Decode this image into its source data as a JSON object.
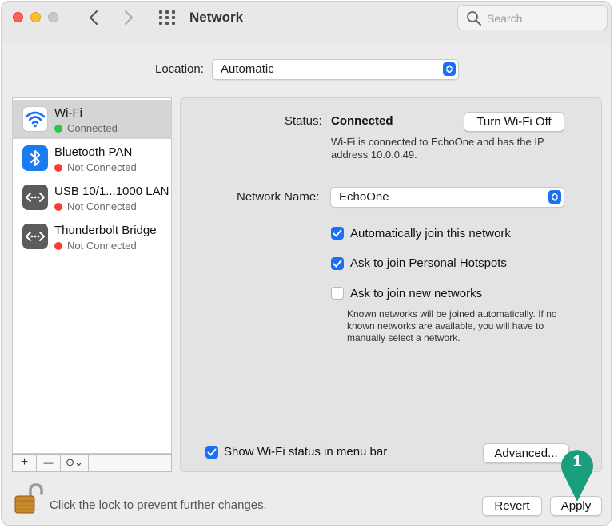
{
  "window": {
    "title": "Network",
    "search_placeholder": "Search"
  },
  "location": {
    "label": "Location:",
    "value": "Automatic"
  },
  "services": [
    {
      "name": "Wi-Fi",
      "status": "Connected",
      "status_color": "#28c840",
      "icon": "wifi-icon",
      "selected": true
    },
    {
      "name": "Bluetooth PAN",
      "status": "Not Connected",
      "status_color": "#ff3b30",
      "icon": "bluetooth-icon",
      "selected": false
    },
    {
      "name": "USB 10/1...1000 LAN",
      "status": "Not Connected",
      "status_color": "#ff3b30",
      "icon": "ethernet-icon",
      "selected": false
    },
    {
      "name": "Thunderbolt Bridge",
      "status": "Not Connected",
      "status_color": "#ff3b30",
      "icon": "ethernet-icon",
      "selected": false
    }
  ],
  "sidebar_tools": {
    "add": "+",
    "remove": "—",
    "action": "⊙⌄"
  },
  "detail": {
    "status_label": "Status:",
    "status_value": "Connected",
    "toggle_button": "Turn Wi-Fi Off",
    "status_description": "Wi-Fi is connected to EchoOne and has the IP address 10.0.0.49.",
    "network_name_label": "Network Name:",
    "network_name_value": "EchoOne",
    "checkboxes": [
      {
        "label": "Automatically join this network",
        "checked": true
      },
      {
        "label": "Ask to join Personal Hotspots",
        "checked": true
      },
      {
        "label": "Ask to join new networks",
        "checked": false
      }
    ],
    "note": "Known networks will be joined automatically. If no known networks are available, you will have to manually select a network.",
    "show_status_label": "Show Wi-Fi status in menu bar",
    "show_status_checked": true,
    "advanced_button": "Advanced..."
  },
  "footer": {
    "lock_text": "Click the lock to prevent further changes.",
    "revert_button": "Revert",
    "apply_button": "Apply"
  },
  "annotation": {
    "marker_number": "1",
    "marker_color": "#1a9e7e"
  },
  "colors": {
    "accent": "#1b6ff5"
  }
}
